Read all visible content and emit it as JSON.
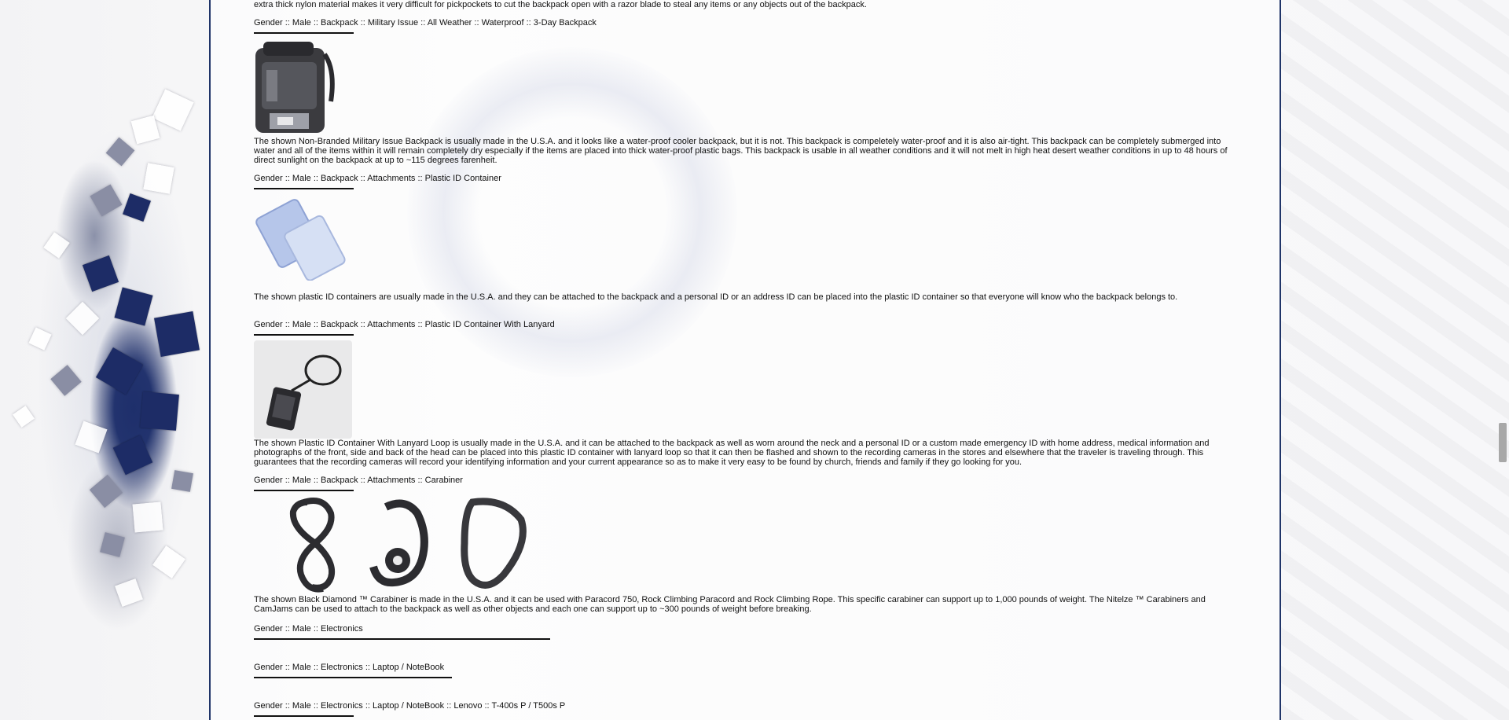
{
  "sections": {
    "top_paragraph": "extra thick nylon material makes it very difficult for pickpockets to cut the backpack open with a razor blade to steal any items or any objects out of the backpack.",
    "backpack_military": {
      "heading": "Gender :: Male :: Backpack :: Military Issue :: All Weather :: Waterproof :: 3-Day Backpack",
      "description": "The shown Non-Branded Military Issue Backpack is usually made in the U.S.A. and it looks like a water-proof cooler backpack, but it is not. This backpack is compeletely water-proof and it is also air-tight. This backpack can be completely submerged into water and all of the items within it will remain completely dry especially if the items are placed into thick water-proof plastic bags. This backpack is usable in all weather conditions and it will not melt in high heat desert weather conditions in up to 48 hours of direct sunlight on the backpack at up to ~115 degrees farenheit."
    },
    "plastic_id": {
      "heading": "Gender :: Male :: Backpack :: Attachments :: Plastic ID Container",
      "description": "The shown plastic ID containers are usually made in the U.S.A. and they can be attached to the backpack and a personal ID or an address ID can be placed into the plastic ID container so that everyone will know who the backpack belongs to."
    },
    "plastic_id_lanyard": {
      "heading": "Gender :: Male :: Backpack :: Attachments :: Plastic ID Container With Lanyard",
      "description": "The shown Plastic ID Container With Lanyard Loop is usually made in the U.S.A. and it can be attached to the backpack as well as worn around the neck and a personal ID or a custom made emergency ID with home address, medical information and photographs of the front, side and back of the head can be placed into this plastic ID container with lanyard loop so that it can then be flashed and shown to the recording cameras in the stores and elsewhere that the traveler is traveling through. This guarantees that the recording cameras will record your identifying information and your current appearance so as to make it very easy to be found by church, friends and family if they go looking for you."
    },
    "carabiner": {
      "heading": "Gender :: Male :: Backpack :: Attachments :: Carabiner",
      "description": "The shown Black Diamond ™ Carabiner is made in the U.S.A. and it can be used with Paracord 750, Rock Climbing Paracord and Rock Climbing Rope. This specific carabiner can support up to 1,000 pounds of weight. The Nitelze ™ Carabiners and CamJams can be used to attach to the backpack as well as other objects and each one can support up to ~300 pounds of weight before breaking."
    },
    "electronics": {
      "heading": "Gender :: Male :: Electronics"
    },
    "laptop": {
      "heading": "Gender :: Male :: Electronics :: Laptop / NoteBook"
    },
    "lenovo": {
      "heading": "Gender :: Male :: Electronics :: Laptop / NoteBook :: Lenovo :: T-400s P / T500s P"
    }
  }
}
